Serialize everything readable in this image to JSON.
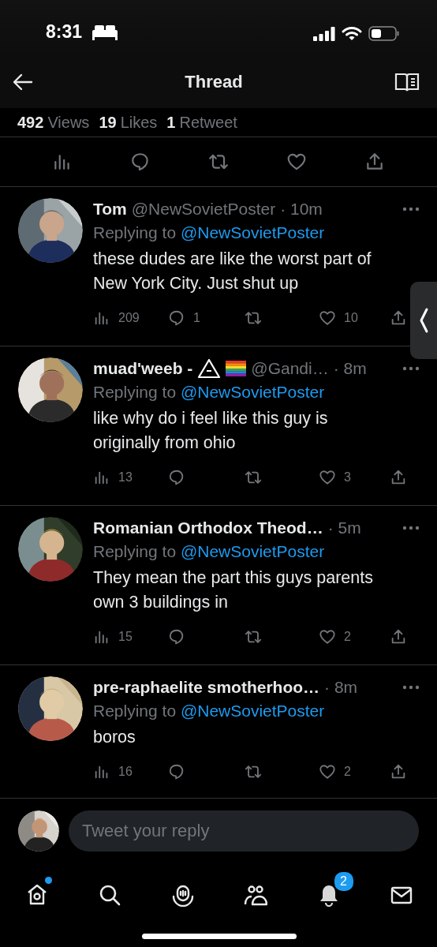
{
  "status_bar": {
    "time": "8:31"
  },
  "header": {
    "title": "Thread"
  },
  "stats": [
    {
      "count": "492",
      "label": "Views"
    },
    {
      "count": "19",
      "label": "Likes"
    },
    {
      "count": "1",
      "label": "Retweet"
    }
  ],
  "tweets": [
    {
      "name": "Tom",
      "handle": "@NewSovietPoster",
      "time": "· 10m",
      "replying_label": "Replying to",
      "replying_to": "@NewSovietPoster",
      "text": "these dudes are like the worst part of New York City. Just shut up",
      "views": "209",
      "replies": "1",
      "likes": "10"
    },
    {
      "name": "muad'weeb -",
      "badges": [
        {
          "kind": "triangle"
        },
        {
          "kind": "rainbow-flag"
        }
      ],
      "handle": "@Gandi…",
      "time": "· 8m",
      "replying_label": "Replying to",
      "replying_to": "@NewSovietPoster",
      "text": "like why do i feel like this guy is originally from ohio",
      "views": "13",
      "likes": "3"
    },
    {
      "name": "Romanian Orthodox Theod…",
      "time": "· 5m",
      "replying_label": "Replying to",
      "replying_to": "@NewSovietPoster",
      "text": "They mean the part this guys parents own 3 buildings in",
      "views": "15",
      "likes": "2"
    },
    {
      "name": "pre-raphaelite smotherhoo…",
      "time": "· 8m",
      "replying_label": "Replying to",
      "replying_to": "@NewSovietPoster",
      "text": "boros",
      "views": "16",
      "likes": "2"
    }
  ],
  "reply_box": {
    "placeholder": "Tweet your reply"
  },
  "nav": [
    {
      "kind": "home",
      "dot": true
    },
    {
      "kind": "search",
      "dot": false
    },
    {
      "kind": "spaces",
      "dot": false
    },
    {
      "kind": "communities",
      "dot": false
    },
    {
      "kind": "notifications",
      "dot": false,
      "badge": "2"
    },
    {
      "kind": "messages",
      "dot": false
    }
  ]
}
